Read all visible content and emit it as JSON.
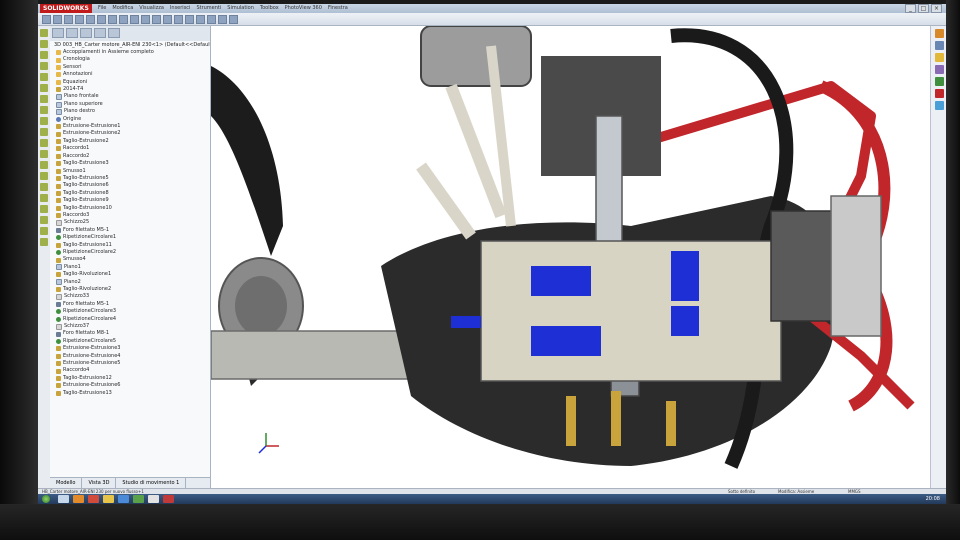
{
  "app": {
    "logo_text": "SOLIDWORKS",
    "menu": [
      "File",
      "Modifica",
      "Visualizza",
      "Inserisci",
      "Strumenti",
      "Simulation",
      "Toolbox",
      "PhotoView 360",
      "Finestra"
    ],
    "window_controls": [
      "_",
      "□",
      "×"
    ]
  },
  "feature_tree": {
    "root": "3D 003_HB_Carter motore_AIR-ENI 230<1> (Default<<Default>_Stato di visualizzazione 1>)",
    "items": [
      {
        "label": "Accoppiamenti in Assieme completo",
        "icon": "folder"
      },
      {
        "label": "Cronologia",
        "icon": "folder"
      },
      {
        "label": "Sensori",
        "icon": "folder"
      },
      {
        "label": "Annotazioni",
        "icon": "folder"
      },
      {
        "label": "Equazioni",
        "icon": "folder"
      },
      {
        "label": "2014-T4",
        "icon": "feature"
      },
      {
        "label": "Piano frontale",
        "icon": "plane"
      },
      {
        "label": "Piano superiore",
        "icon": "plane"
      },
      {
        "label": "Piano destro",
        "icon": "plane"
      },
      {
        "label": "Origine",
        "icon": "origin"
      },
      {
        "label": "Estrusione-Estrusione1",
        "icon": "feature"
      },
      {
        "label": "Estrusione-Estrusione2",
        "icon": "feature"
      },
      {
        "label": "Taglio-Estrusione2",
        "icon": "feature"
      },
      {
        "label": "Raccordo1",
        "icon": "feature"
      },
      {
        "label": "Raccordo2",
        "icon": "feature"
      },
      {
        "label": "Taglio-Estrusione3",
        "icon": "feature"
      },
      {
        "label": "Smusso1",
        "icon": "feature"
      },
      {
        "label": "Taglio-Estrusione5",
        "icon": "feature"
      },
      {
        "label": "Taglio-Estrusione6",
        "icon": "feature"
      },
      {
        "label": "Taglio-Estrusione8",
        "icon": "feature"
      },
      {
        "label": "Taglio-Estrusione9",
        "icon": "feature"
      },
      {
        "label": "Taglio-Estrusione10",
        "icon": "feature"
      },
      {
        "label": "Raccordo3",
        "icon": "feature"
      },
      {
        "label": "Schizzo25",
        "icon": "sketch"
      },
      {
        "label": "Foro filettato M5-1",
        "icon": "hole"
      },
      {
        "label": "RipetizioneCircolare1",
        "icon": "pattern"
      },
      {
        "label": "Taglio-Estrusione11",
        "icon": "feature"
      },
      {
        "label": "RipetizioneCircolare2",
        "icon": "pattern"
      },
      {
        "label": "Smusso4",
        "icon": "feature"
      },
      {
        "label": "Piano1",
        "icon": "plane"
      },
      {
        "label": "Taglio-Rivoluzione1",
        "icon": "feature"
      },
      {
        "label": "Piano2",
        "icon": "plane"
      },
      {
        "label": "Taglio-Rivoluzione2",
        "icon": "feature"
      },
      {
        "label": "Schizzo33",
        "icon": "sketch"
      },
      {
        "label": "Foro filettato M5-1",
        "icon": "hole"
      },
      {
        "label": "RipetizioneCircolare3",
        "icon": "pattern"
      },
      {
        "label": "RipetizioneCircolare4",
        "icon": "pattern"
      },
      {
        "label": "Schizzo37",
        "icon": "sketch"
      },
      {
        "label": "Foro filettato M8-1",
        "icon": "hole"
      },
      {
        "label": "RipetizioneCircolare5",
        "icon": "pattern"
      },
      {
        "label": "Estrusione-Estrusione3",
        "icon": "feature"
      },
      {
        "label": "Estrusione-Estrusione4",
        "icon": "feature"
      },
      {
        "label": "Estrusione-Estrusione5",
        "icon": "feature"
      },
      {
        "label": "Raccordo4",
        "icon": "feature"
      },
      {
        "label": "Taglio-Estrusione12",
        "icon": "feature"
      },
      {
        "label": "Estrusione-Estrusione6",
        "icon": "feature"
      },
      {
        "label": "Taglio-Estrusione13",
        "icon": "feature"
      }
    ],
    "bottom_tabs": [
      "Modello",
      "Vista 3D",
      "Studio di movimento 1"
    ]
  },
  "statusbar": {
    "left": "HB_Carter motore_AIR-ENI 230 per nuovo flusso+1",
    "mid": "Sotto definito",
    "mid2": "Modifica: Assieme",
    "right": "MMGS"
  },
  "taskbar": {
    "clock": "20:08"
  },
  "colors": {
    "viewport_background": "#ffffff",
    "frame_red": "#c0262a",
    "section_blue": "#1e2fd6",
    "housing_dark": "#2a2a2a"
  }
}
